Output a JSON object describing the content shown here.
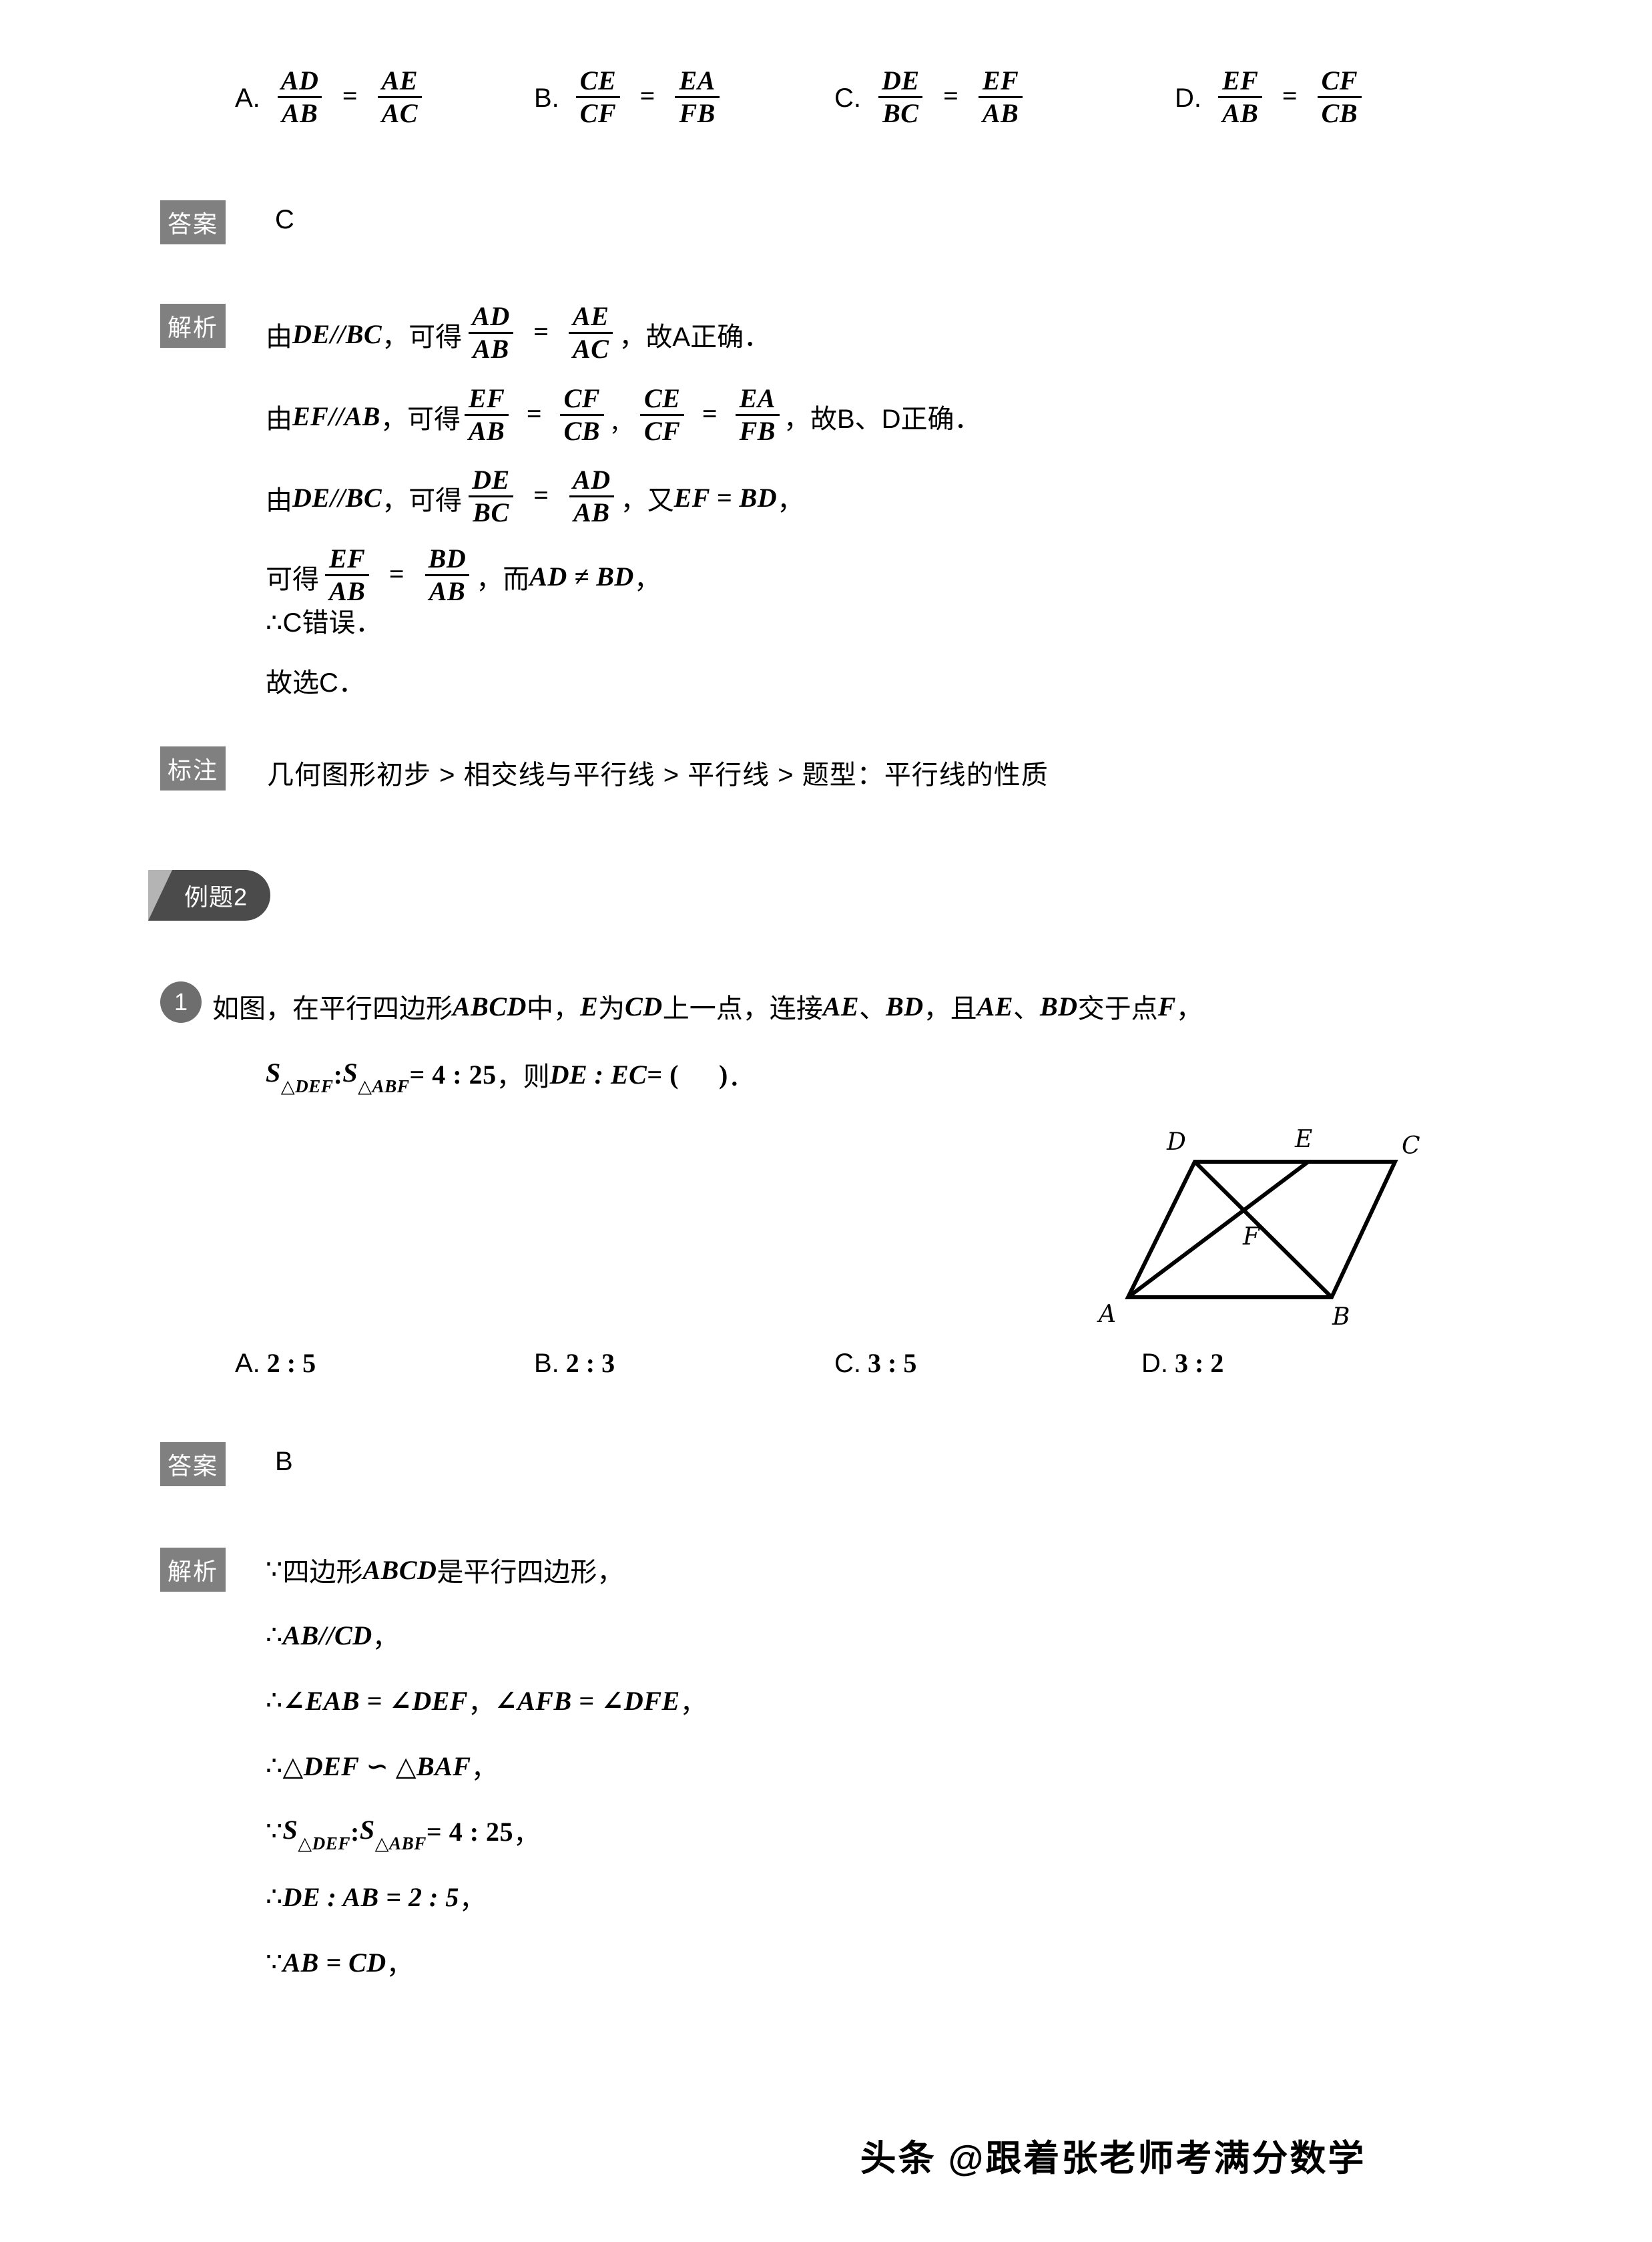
{
  "question1": {
    "options": [
      {
        "label": "A.",
        "num1": "AD",
        "den1": "AB",
        "num2": "AE",
        "den2": "AC"
      },
      {
        "label": "B.",
        "num1": "CE",
        "den1": "CF",
        "num2": "EA",
        "den2": "FB"
      },
      {
        "label": "C.",
        "num1": "DE",
        "den1": "BC",
        "num2": "EF",
        "den2": "AB"
      },
      {
        "label": "D.",
        "num1": "EF",
        "den1": "AB",
        "num2": "CF",
        "den2": "CB"
      }
    ],
    "answer_label": "答案",
    "answer_value": "C",
    "analysis_label": "解析",
    "analysis": {
      "l1_a": "由",
      "l1_b": "DE//BC",
      "l1_c": "，可得",
      "l1_n1": "AD",
      "l1_d1": "AB",
      "l1_n2": "AE",
      "l1_d2": "AC",
      "l1_tail": "，故A正确．",
      "l2_a": "由",
      "l2_b": "EF//AB",
      "l2_c": "，可得",
      "l2_n1": "EF",
      "l2_d1": "AB",
      "l2_n2": "CF",
      "l2_d2": "CB",
      "l2_n3": "CE",
      "l2_d3": "CF",
      "l2_n4": "EA",
      "l2_d4": "FB",
      "l2_tail": "，故B、D正确．",
      "l3_a": "由",
      "l3_b": "DE//BC",
      "l3_c": "，可得",
      "l3_n1": "DE",
      "l3_d1": "BC",
      "l3_n2": "AD",
      "l3_d2": "AB",
      "l3_d": "，又",
      "l3_e": "EF = BD",
      "l3_tail": "，",
      "l4_a": "可得",
      "l4_n1": "EF",
      "l4_d1": "AB",
      "l4_n2": "BD",
      "l4_d2": "AB",
      "l4_c": "，而",
      "l4_d": "AD ≠ BD",
      "l4_tail": "，",
      "l5": "∴C错误．",
      "l6": "故选C．"
    },
    "tag_label": "标注",
    "tag_path": "几何图形初步 > 相交线与平行线 > 平行线 > 题型：平行线的性质"
  },
  "example2": {
    "banner": "例题2",
    "number_badge": "1",
    "stem_line1_a": "如图，在平行四边形",
    "stem_line1_b": "ABCD",
    "stem_line1_c": "中，",
    "stem_line1_d": "E",
    "stem_line1_e": "为",
    "stem_line1_f": "CD",
    "stem_line1_g": "上一点，连接",
    "stem_line1_h": "AE",
    "stem_line1_i": "、",
    "stem_line1_j": "BD",
    "stem_line1_k": "，且",
    "stem_line1_l": "AE",
    "stem_line1_m": "、",
    "stem_line1_n": "BD",
    "stem_line1_o": "交于点",
    "stem_line1_p": "F",
    "stem_line1_q": "，",
    "stem_line2_s1": "S",
    "stem_line2_sub1": "△DEF",
    "stem_line2_colon": " : ",
    "stem_line2_s2": "S",
    "stem_line2_sub2": "△ABF",
    "stem_line2_eq": " = 4 : 25",
    "stem_line2_then": "，则",
    "stem_line2_ratio": "DE : EC",
    "stem_line2_eq2": " = (",
    "stem_line2_close": ")",
    "stem_line2_period": "．",
    "figure": {
      "vertex_A": "A",
      "vertex_B": "B",
      "vertex_C": "C",
      "vertex_D": "D",
      "vertex_E": "E",
      "vertex_F": "F"
    },
    "options": [
      {
        "label": "A.",
        "value": "2 : 5"
      },
      {
        "label": "B.",
        "value": "2 : 3"
      },
      {
        "label": "C.",
        "value": "3 : 5"
      },
      {
        "label": "D.",
        "value": "3 : 2"
      }
    ],
    "answer_label": "答案",
    "answer_value": "B",
    "analysis_label": "解析",
    "analysis": {
      "l1_sym": "∵",
      "l1_a": "四边形",
      "l1_b": "ABCD",
      "l1_c": "是平行四边形，",
      "l2_sym": "∴",
      "l2_a": "AB//CD",
      "l2_tail": "，",
      "l3_sym": "∴",
      "l3_a": "∠EAB = ∠DEF",
      "l3_mid": "，",
      "l3_b": "∠AFB = ∠DFE",
      "l3_tail": "，",
      "l4_sym": "∴",
      "l4_a": "△DEF ∽ △BAF",
      "l4_tail": "，",
      "l5_sym": "∵",
      "l5_s1": "S",
      "l5_sub1": "△DEF",
      "l5_colon": " : ",
      "l5_s2": "S",
      "l5_sub2": "△ABF",
      "l5_eq": " = 4 : 25",
      "l5_tail": "，",
      "l6_sym": "∴",
      "l6_a": "DE : AB = 2 : 5",
      "l6_tail": "，",
      "l7_sym": "∵",
      "l7_a": "AB = CD",
      "l7_tail": "，"
    }
  },
  "footer": {
    "text": "头条 @跟着张老师考满分数学"
  },
  "colors": {
    "chip_gray": "#808080",
    "banner_dark": "#4b4b4b",
    "banner_light": "#b4b4b4",
    "badge_gray": "#6e6e6e"
  }
}
